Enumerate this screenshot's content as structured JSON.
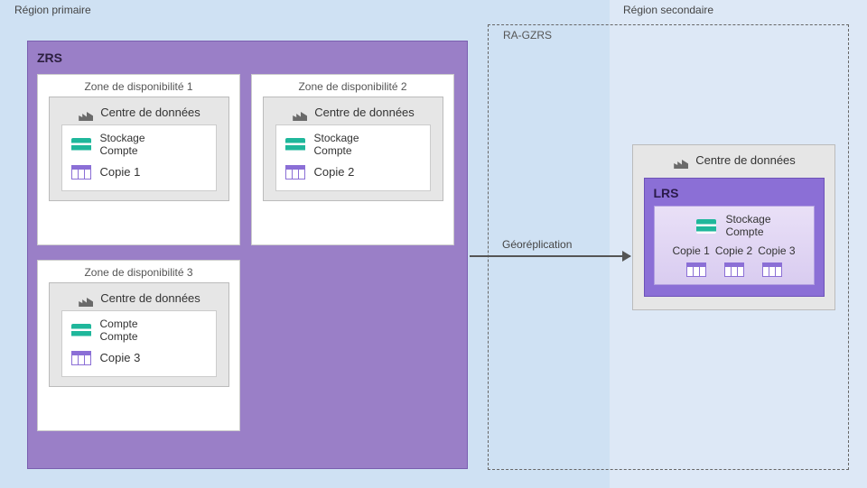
{
  "regions": {
    "primary_label": "Région primaire",
    "secondary_label": "Région secondaire"
  },
  "ragzrs_label": "RA-GZRS",
  "geo_label": "Géoréplication",
  "zrs": {
    "title": "ZRS",
    "zones": [
      {
        "title": "Zone de disponibilité 1",
        "dc_label": "Centre de données",
        "line1": "Stockage",
        "line2": "Compte",
        "copy": "Copie 1"
      },
      {
        "title": "Zone de disponibilité 2",
        "dc_label": "Centre de données",
        "line1": "Stockage",
        "line2": "Compte",
        "copy": "Copie 2"
      },
      {
        "title": "Zone de disponibilité 3",
        "dc_label": "Centre de données",
        "line1": "Compte",
        "line2": "Compte",
        "copy": "Copie 3"
      }
    ]
  },
  "secondary": {
    "dc_label": "Centre de données",
    "lrs_title": "LRS",
    "line1": "Stockage",
    "line2": "Compte",
    "copies": [
      "Copie 1",
      "Copie 2",
      "Copie 3"
    ]
  }
}
